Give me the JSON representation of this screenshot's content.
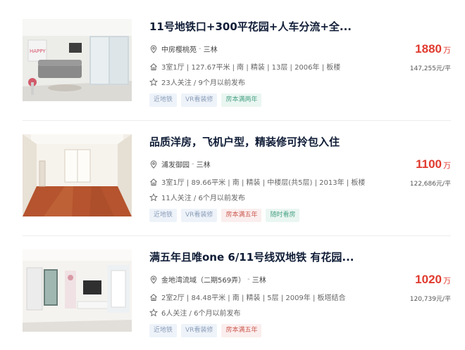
{
  "colors": {
    "price": "#e03a2e",
    "title": "#101d37"
  },
  "listings": [
    {
      "title": "11号地铁口+300平花园+人车分流+全...",
      "community": "中房樱桃苑",
      "area": "三林",
      "info": [
        "3室1厅",
        "127.67平米",
        "南",
        "精装",
        "13层",
        "2006年",
        "板楼"
      ],
      "follow": "23人关注 / 9个月以前发布",
      "tags": [
        {
          "label": "近地铁",
          "style": "blue"
        },
        {
          "label": "VR看装修",
          "style": "blue"
        },
        {
          "label": "房本满两年",
          "style": "green"
        }
      ],
      "total_price": "1880",
      "price_unit": "万",
      "unit_price": "147,255元/平"
    },
    {
      "title": "品质洋房，飞机户型，精装修可拎包入住",
      "community": "浦发御园",
      "area": "三林",
      "info": [
        "3室1厅",
        "89.66平米",
        "南",
        "精装",
        "中楼层(共5层)",
        "2013年",
        "板楼"
      ],
      "follow": "11人关注 / 6个月以前发布",
      "tags": [
        {
          "label": "近地铁",
          "style": "blue"
        },
        {
          "label": "VR看装修",
          "style": "blue"
        },
        {
          "label": "房本满五年",
          "style": "red"
        },
        {
          "label": "随时看房",
          "style": "green"
        }
      ],
      "total_price": "1100",
      "price_unit": "万",
      "unit_price": "122,686元/平"
    },
    {
      "title": "满五年且唯one 6/11号线双地铁 有花园...",
      "community": "金地湾流域（二期569弄）",
      "area": "三林",
      "info": [
        "2室2厅",
        "84.48平米",
        "南",
        "精装",
        "5层",
        "2009年",
        "板塔结合"
      ],
      "follow": "6人关注 / 6个月以前发布",
      "tags": [
        {
          "label": "近地铁",
          "style": "blue"
        },
        {
          "label": "VR看装修",
          "style": "blue"
        },
        {
          "label": "房本满五年",
          "style": "red"
        }
      ],
      "total_price": "1020",
      "price_unit": "万",
      "unit_price": "120,739元/平"
    }
  ]
}
